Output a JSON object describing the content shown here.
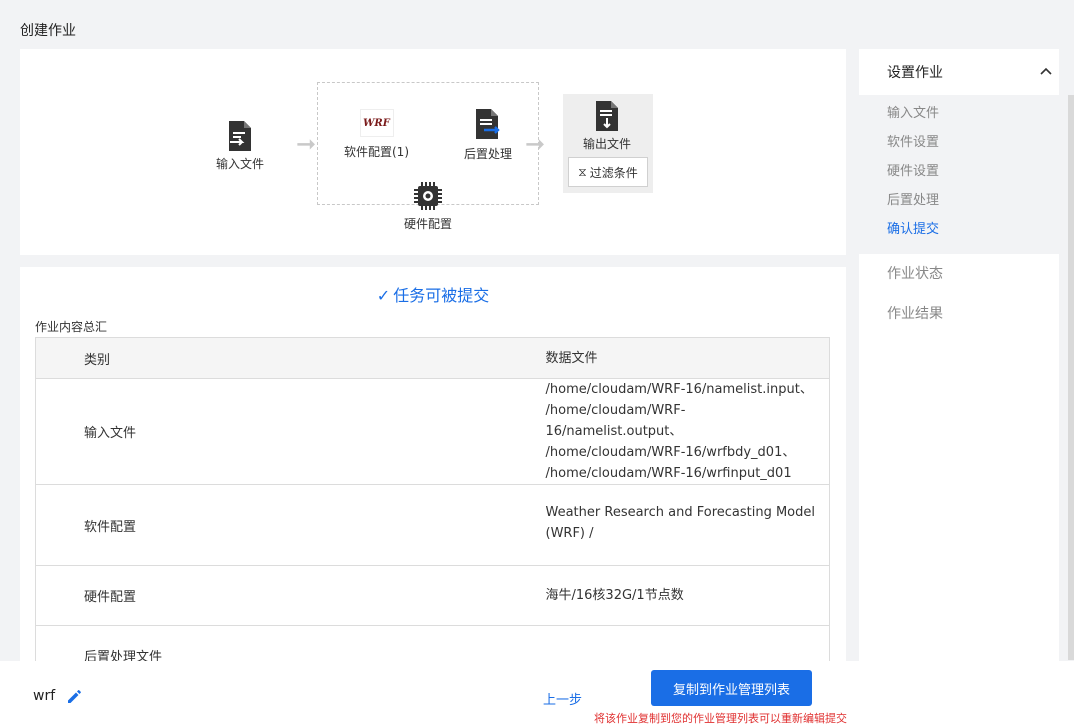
{
  "page": {
    "title": "创建作业"
  },
  "workflow": {
    "input_files": "输入文件",
    "software_config": "软件配置(1)",
    "post_processing": "后置处理",
    "hardware_config": "硬件配置",
    "output_files": "输出文件",
    "filter_conditions": "过滤条件",
    "software_logo_text": "WRF"
  },
  "summary": {
    "status": "任务可被提交",
    "title": "作业内容总汇",
    "columns": [
      "类别",
      "数据文件"
    ],
    "rows": [
      {
        "category": "输入文件",
        "data": [
          "/home/cloudam/WRF-16/namelist.input、",
          "/home/cloudam/WRF-16/namelist.output、",
          "/home/cloudam/WRF-16/wrfbdy_d01、",
          "/home/cloudam/WRF-16/wrfinput_d01"
        ]
      },
      {
        "category": "软件配置",
        "data": [
          "Weather Research and Forecasting Model",
          "(WRF) /"
        ]
      },
      {
        "category": "硬件配置",
        "data": [
          "海牛/16核32G/1节点数"
        ]
      },
      {
        "category": "后置处理文件",
        "data": []
      }
    ]
  },
  "sidebar": {
    "header": "设置作业",
    "sub_items": [
      {
        "label": "输入文件",
        "active": false
      },
      {
        "label": "软件设置",
        "active": false
      },
      {
        "label": "硬件设置",
        "active": false
      },
      {
        "label": "后置处理",
        "active": false
      },
      {
        "label": "确认提交",
        "active": true
      }
    ],
    "items": [
      {
        "label": "作业状态"
      },
      {
        "label": "作业结果"
      }
    ]
  },
  "bottom": {
    "job_name": "wrf",
    "prev_label": "上一步",
    "copy_label": "复制到作业管理列表",
    "hint": "将该作业复制到您的作业管理列表可以重新编辑提交"
  },
  "colors": {
    "accent": "#1a6ee6",
    "hint": "#e03030"
  }
}
